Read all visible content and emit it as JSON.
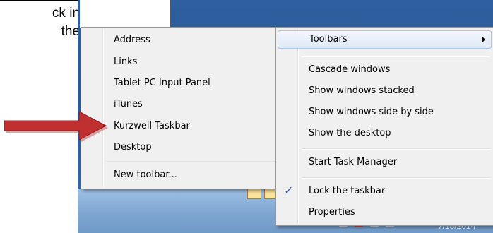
{
  "document": {
    "line1": "ck in",
    "line2": "the"
  },
  "toolbars_submenu": {
    "items": [
      "Address",
      "Links",
      "Tablet PC Input Panel",
      "iTunes",
      "Kurzweil Taskbar",
      "Desktop"
    ],
    "new_toolbar": "New toolbar..."
  },
  "context_menu": {
    "toolbars": "Toolbars",
    "cascade": "Cascade windows",
    "stacked": "Show windows stacked",
    "side_by_side": "Show windows side by side",
    "show_desktop": "Show the desktop",
    "task_manager": "Start Task Manager",
    "lock_taskbar": "Lock the taskbar",
    "lock_check": "✓",
    "properties": "Properties"
  },
  "taskbar": {
    "clock": "7/18/2014"
  },
  "colors": {
    "annotation_arrow": "#c03030",
    "desktop": "#2f5f9e",
    "menu_bg": "#f0f0f0"
  }
}
